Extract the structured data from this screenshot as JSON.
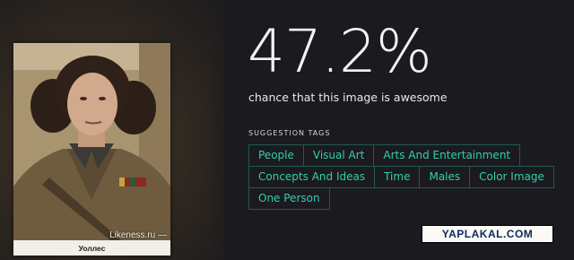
{
  "photo": {
    "watermark_site": "Likeness.ru —",
    "caption": "Уоллес"
  },
  "result": {
    "score": "47.2%",
    "score_caption": "chance that this image is awesome"
  },
  "suggestions": {
    "heading": "SUGGESTION TAGS",
    "rows": [
      [
        "People",
        "Visual Art",
        "Arts And Entertainment"
      ],
      [
        "Concepts And Ideas",
        "Time",
        "Males",
        "Color Image"
      ],
      [
        "One Person"
      ]
    ]
  },
  "watermark": {
    "text": "YAPLAKAL.COM"
  },
  "colors": {
    "background": "#1b1a1e",
    "tag_text": "#2fd0b0",
    "tag_border": "#1d5b52",
    "score_text": "#f3f3f3"
  }
}
